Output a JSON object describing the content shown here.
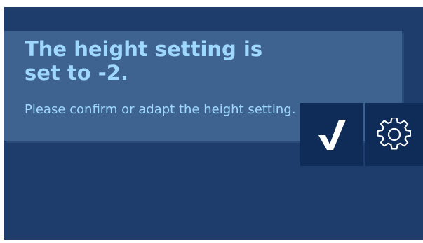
{
  "dialog": {
    "title": "The height setting is set to -2.",
    "message": "Please confirm or adapt the height setting."
  },
  "actions": {
    "confirm_icon": "checkmark-icon",
    "settings_icon": "gear-icon"
  },
  "colors": {
    "background": "#1f3d6c",
    "card": "#3f6391",
    "text": "#9fd8ff",
    "button": "#0f2c58",
    "icon": "#ffffff"
  }
}
